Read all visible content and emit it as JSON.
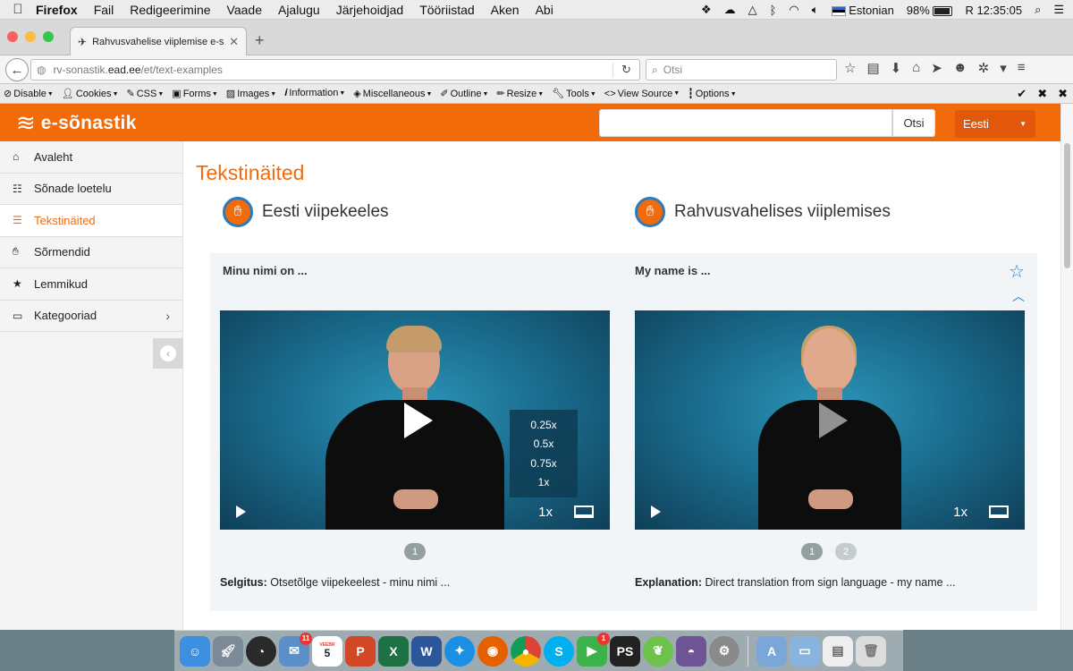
{
  "menubar": {
    "apple": "",
    "app": "Firefox",
    "items": [
      "Fail",
      "Redigeerimine",
      "Vaade",
      "Ajalugu",
      "Järjehoidjad",
      "Tööriistad",
      "Aken",
      "Abi"
    ],
    "input_source": "Estonian",
    "battery": "98%",
    "clock": "R 12:35:05"
  },
  "browser": {
    "tab_title": "Rahvusvahelise viiplemise e-s…",
    "url_host": "rv-sonastik.",
    "url_domain": "ead.ee",
    "url_path": "/et/text-examples",
    "search_placeholder": "Otsi"
  },
  "devtoolbar": {
    "items": [
      "Disable",
      "Cookies",
      "CSS",
      "Forms",
      "Images",
      "Information",
      "Miscellaneous",
      "Outline",
      "Resize",
      "Tools",
      "View Source",
      "Options"
    ]
  },
  "site": {
    "brand": "e-sõnastik",
    "search_button": "Otsi",
    "search_value": "",
    "language": "Eesti"
  },
  "sidebar": {
    "items": [
      {
        "label": "Avaleht",
        "icon": "home-icon"
      },
      {
        "label": "Sõnade loetelu",
        "icon": "list-icon"
      },
      {
        "label": "Tekstinäited",
        "icon": "bullet-list-icon"
      },
      {
        "label": "Sõrmendid",
        "icon": "hand-icon"
      },
      {
        "label": "Lemmikud",
        "icon": "star-icon"
      },
      {
        "label": "Kategooriad",
        "icon": "monitor-icon"
      }
    ],
    "active_index": 2
  },
  "main": {
    "title": "Tekstinäited",
    "left": {
      "heading": "Eesti viipekeeles",
      "phrase": "Minu nimi on ...",
      "explanation_label": "Selgitus:",
      "explanation_text": " Otsetõlge viipekeelest - minu nimi ...",
      "speed": "1x",
      "speed_options": [
        "0.25x",
        "0.5x",
        "0.75x",
        "1x"
      ],
      "pages": [
        "1"
      ]
    },
    "right": {
      "heading": "Rahvusvahelises viiplemises",
      "phrase": "My name is ...",
      "explanation_label": "Explanation:",
      "explanation_text": " Direct translation from sign language - my name ...",
      "speed": "1x",
      "pages": [
        "1",
        "2"
      ]
    }
  },
  "dock": {
    "calendar_month": "VEEBR",
    "calendar_day": "5",
    "badges": {
      "mail": "11",
      "facetime": "1"
    }
  },
  "colors": {
    "brand_orange": "#f26b0b",
    "accent_blue": "#2b7bbf"
  }
}
